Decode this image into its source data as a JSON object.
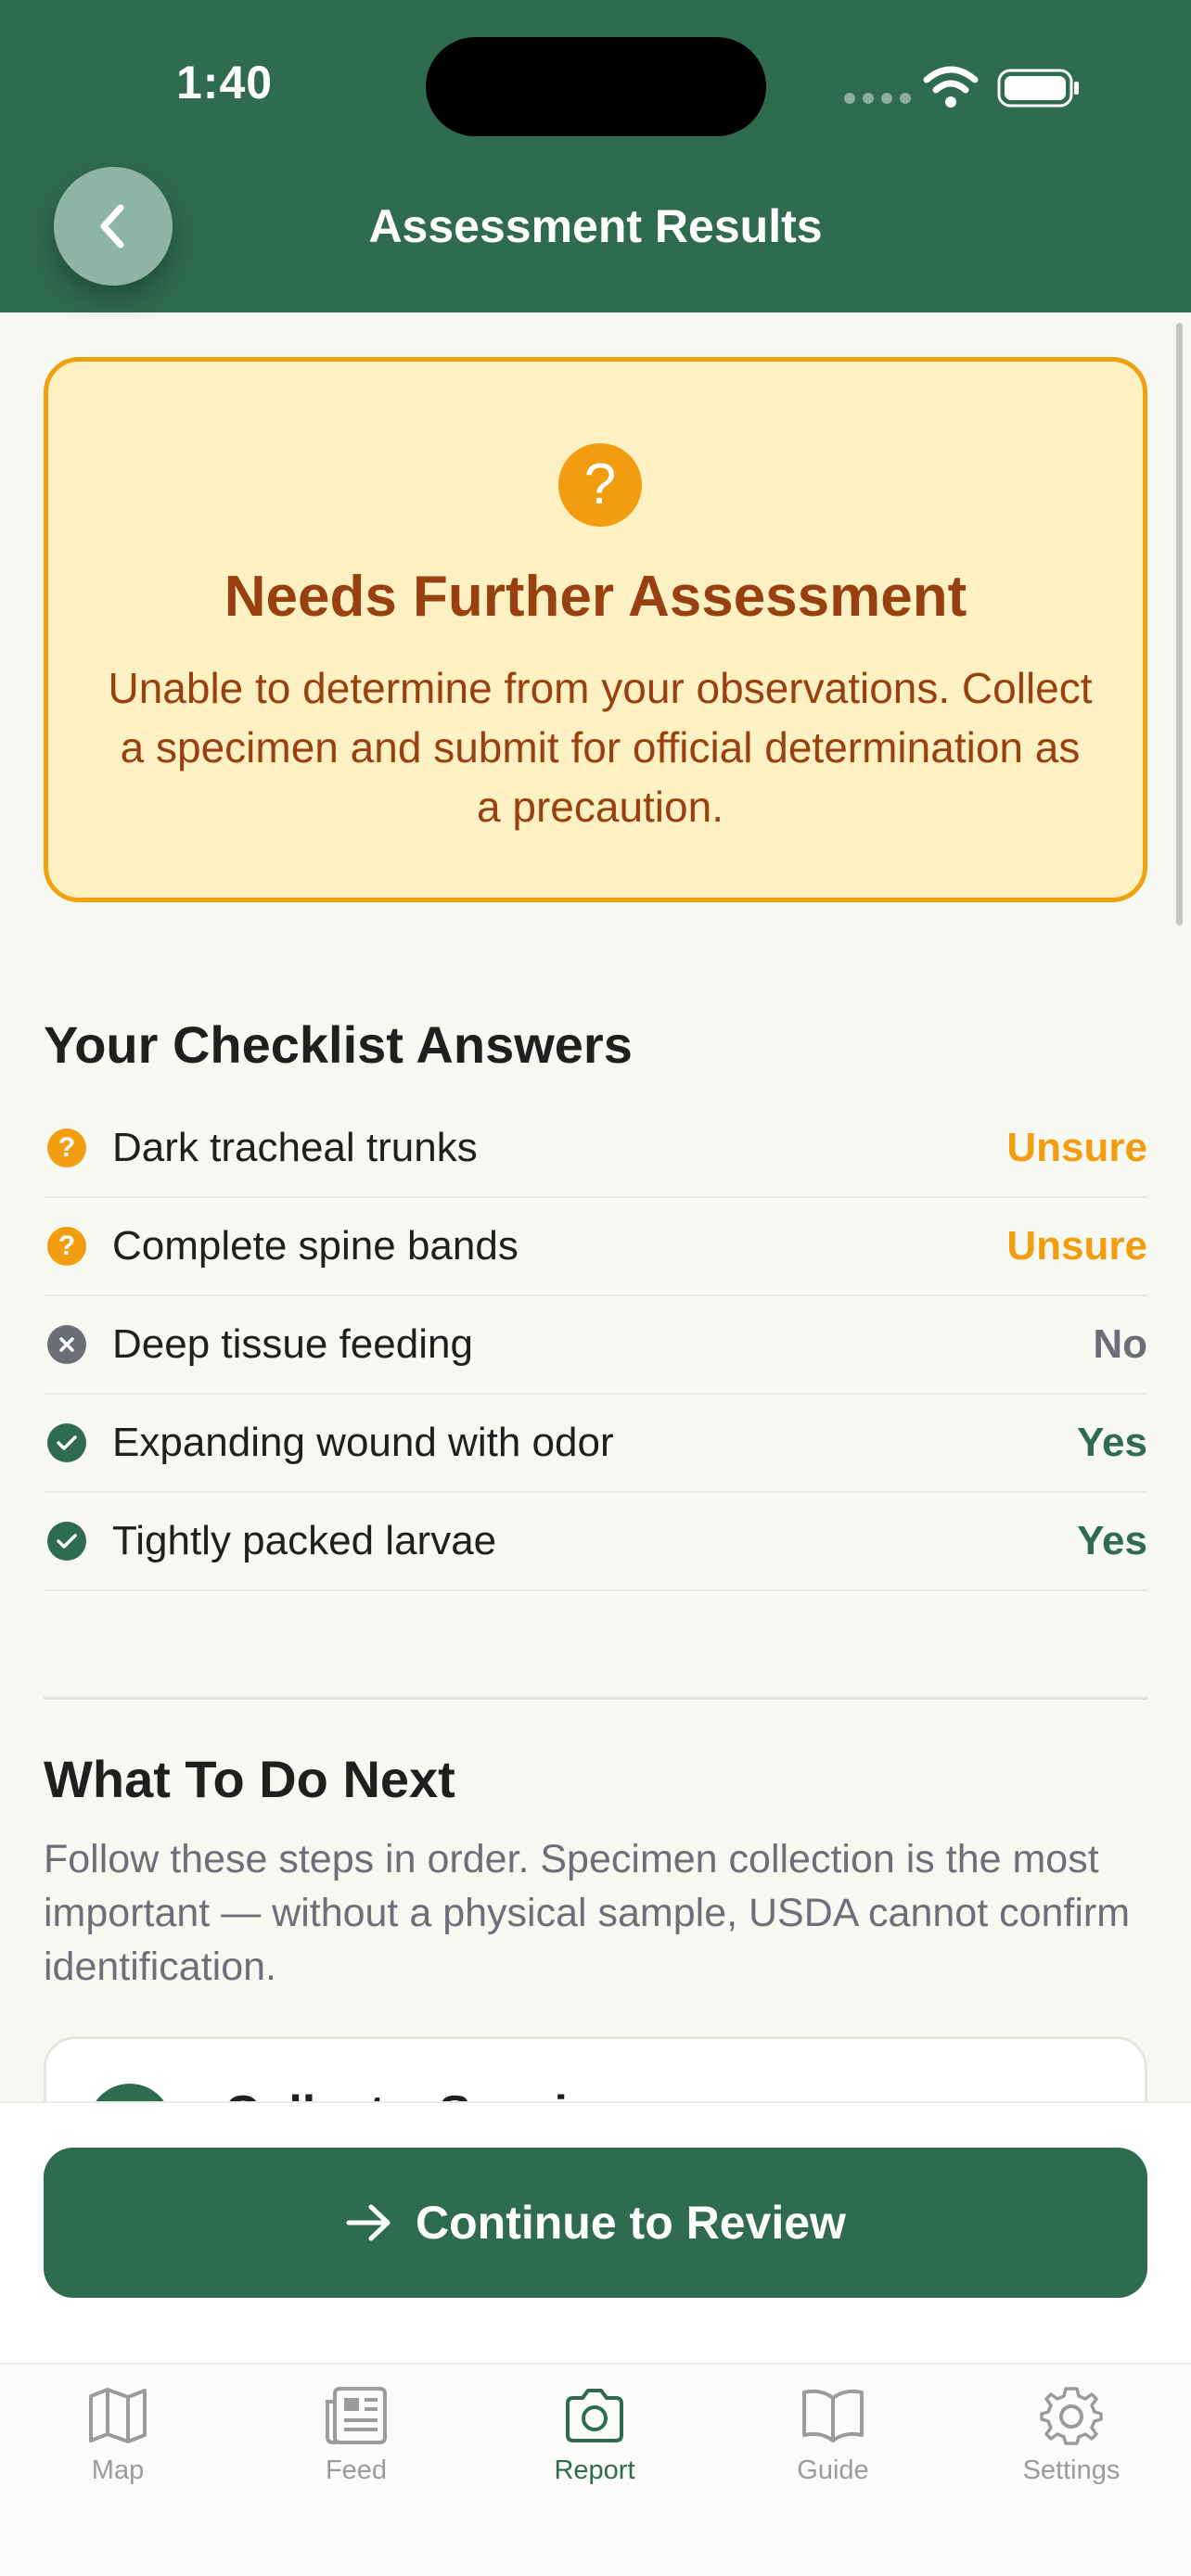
{
  "status_bar": {
    "time": "1:40"
  },
  "header": {
    "title": "Assessment Results"
  },
  "result": {
    "title": "Needs Further Assessment",
    "body": "Unable to determine from your observations. Collect a specimen and submit for official determination as a precaution.",
    "icon_glyph": "?",
    "colors": {
      "accent": "#f0a10f",
      "text": "#98400f",
      "background": "#fdf1c3"
    }
  },
  "checklist": {
    "title": "Your Checklist Answers",
    "items": [
      {
        "label": "Dark tracheal trunks",
        "answer": "Unsure",
        "status": "unsure"
      },
      {
        "label": "Complete spine bands",
        "answer": "Unsure",
        "status": "unsure"
      },
      {
        "label": "Deep tissue feeding",
        "answer": "No",
        "status": "no"
      },
      {
        "label": "Expanding wound with odor",
        "answer": "Yes",
        "status": "yes"
      },
      {
        "label": "Tightly packed larvae",
        "answer": "Yes",
        "status": "yes"
      }
    ],
    "status_colors": {
      "unsure": "#f29d0f",
      "no": "#6b6e77",
      "yes": "#2f6b4f"
    }
  },
  "next_steps": {
    "title": "What To Do Next",
    "description": "Follow these steps in order. Specimen collection is the most important — without a physical sample, USDA cannot confirm identification.",
    "first_step_title": "Collect a Specimen"
  },
  "action": {
    "continue_label": "Continue to Review"
  },
  "tabs": [
    {
      "label": "Map",
      "icon": "map-icon",
      "active": false
    },
    {
      "label": "Feed",
      "icon": "newspaper-icon",
      "active": false
    },
    {
      "label": "Report",
      "icon": "camera-icon",
      "active": true
    },
    {
      "label": "Guide",
      "icon": "book-icon",
      "active": false
    },
    {
      "label": "Settings",
      "icon": "gear-icon",
      "active": false
    }
  ],
  "colors": {
    "brand": "#2f6b4f",
    "background": "#f8f8f3"
  }
}
